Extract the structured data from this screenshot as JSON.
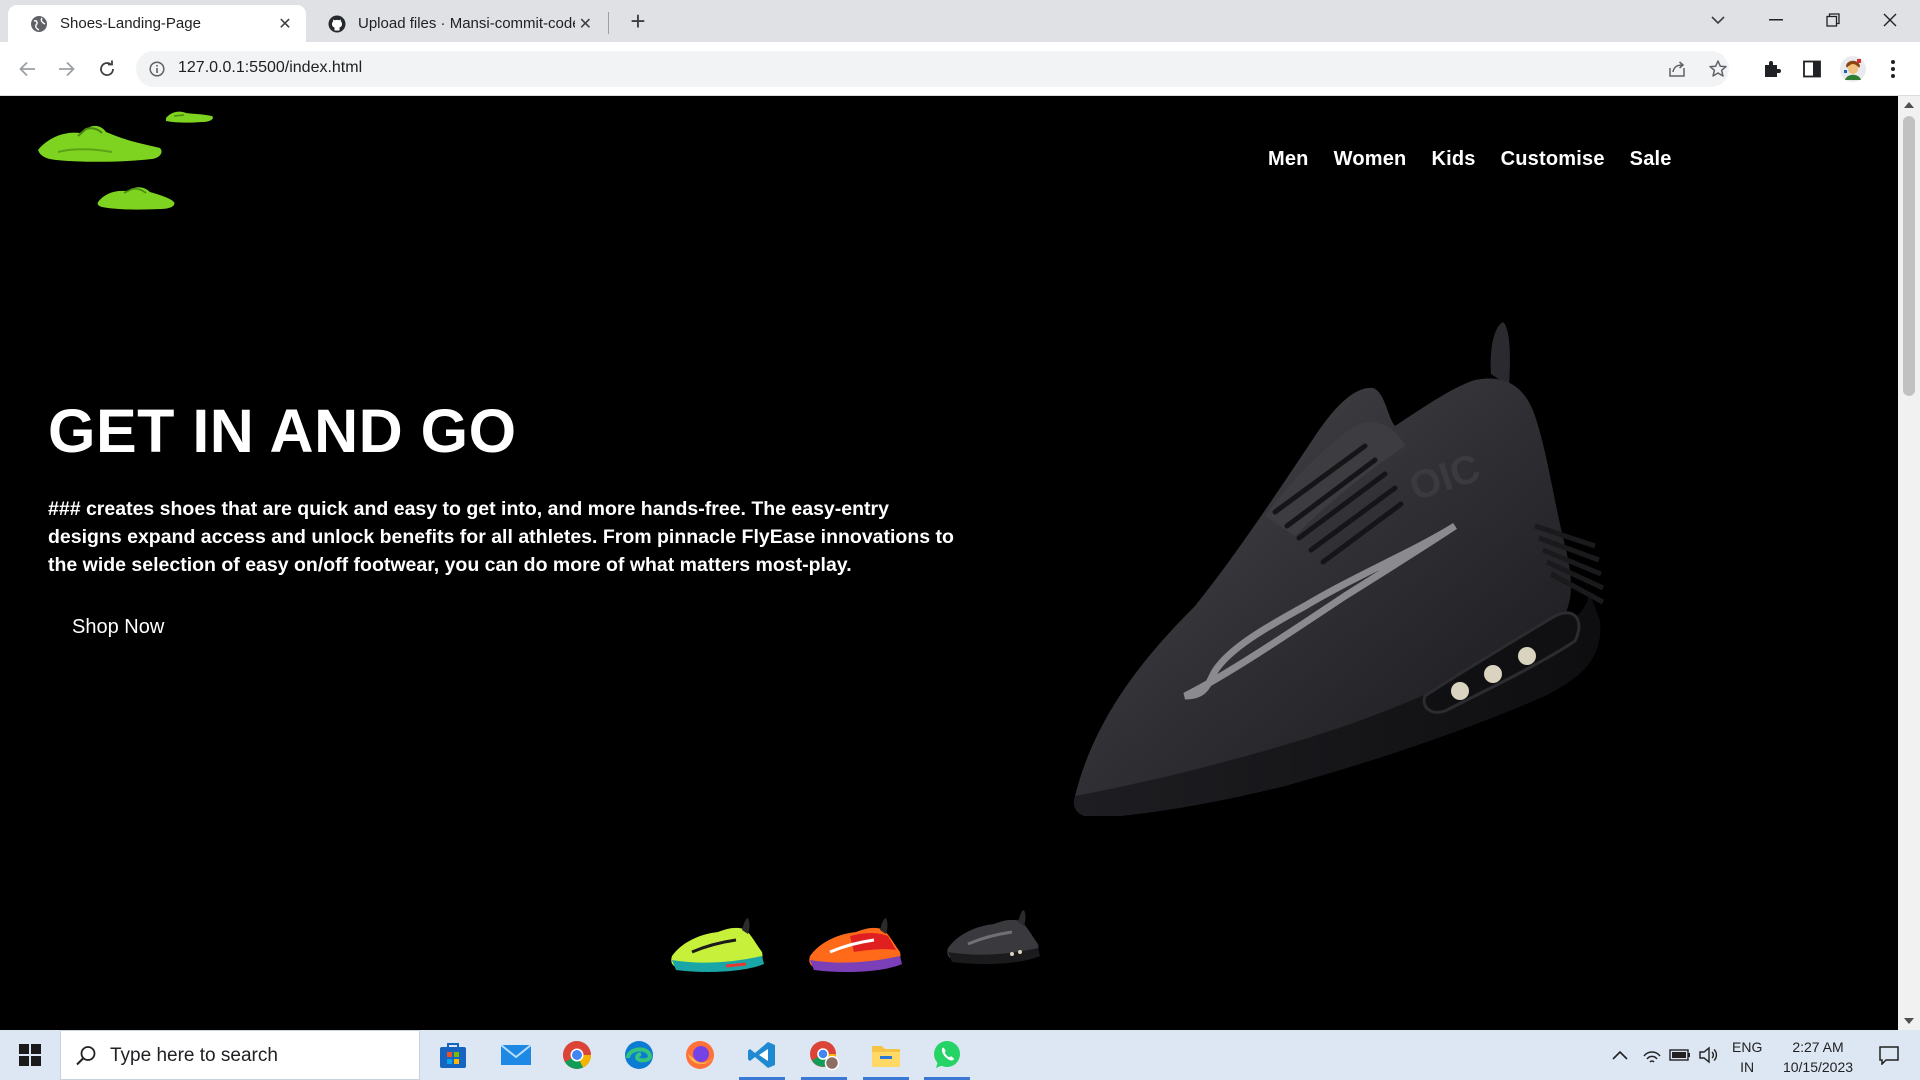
{
  "browser": {
    "tabs": [
      {
        "title": "Shoes-Landing-Page",
        "active": true,
        "icon": "globe-icon"
      },
      {
        "title": "Upload files · Mansi-commit-code",
        "active": false,
        "icon": "github-icon"
      }
    ],
    "url": "127.0.0.1:5500/index.html"
  },
  "page": {
    "nav": [
      "Men",
      "Women",
      "Kids",
      "Customise",
      "Sale"
    ],
    "hero_title": "GET IN AND GO",
    "hero_description": "### creates shoes that are quick and easy to get into, and more hands-free. The easy-entry designs expand access and unlock benefits for all athletes. From pinnacle FlyEase innovations to the wide selection of easy on/off footwear, you can do more of what matters most-play.",
    "cta": "Shop Now",
    "thumbnails": [
      "neon-green-shoe",
      "orange-red-shoe",
      "black-shoe"
    ]
  },
  "taskbar": {
    "search_placeholder": "Type here to search",
    "apps": [
      "store-icon",
      "mail-icon",
      "chrome-icon",
      "edge-icon",
      "firefox-icon",
      "vscode-icon",
      "chrome-profile-icon",
      "file-explorer-icon",
      "whatsapp-icon"
    ],
    "lang_top": "ENG",
    "lang_bottom": "IN",
    "time": "2:27 AM",
    "date": "10/15/2023"
  },
  "colors": {
    "accent_green": "#7ed321",
    "page_background": "#000000",
    "taskbar_background": "#dde7f4"
  }
}
